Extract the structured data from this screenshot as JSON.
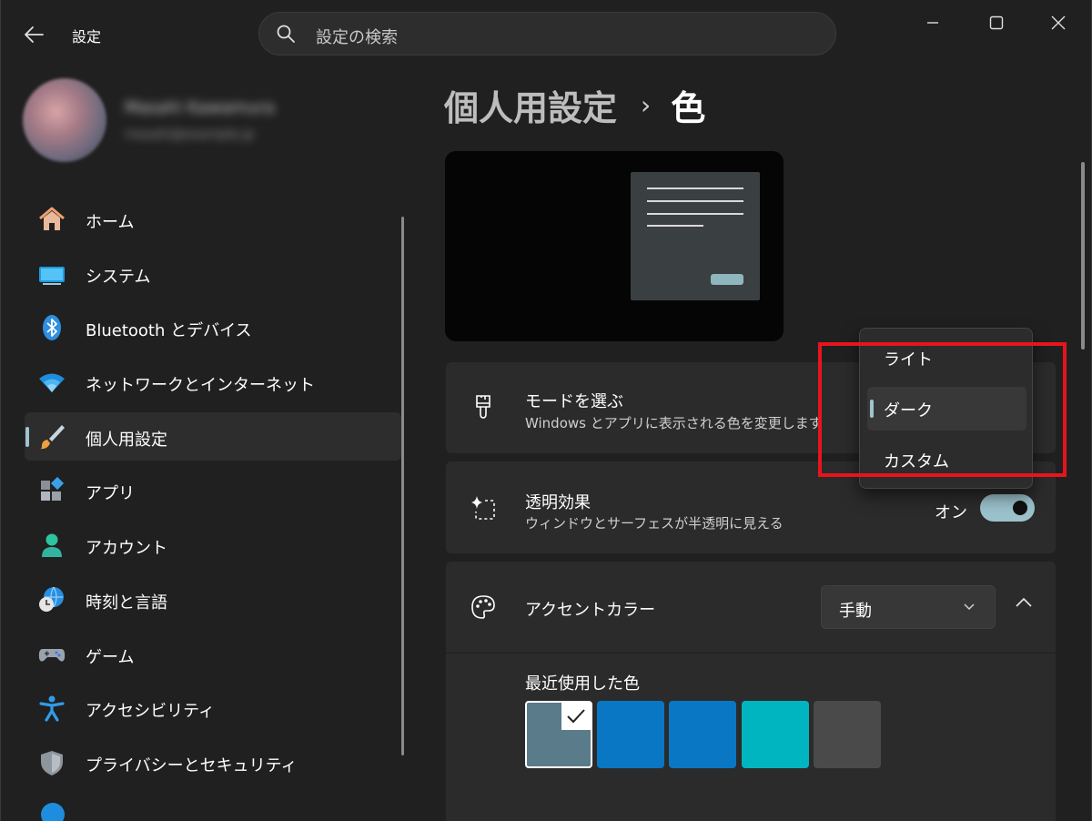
{
  "window": {
    "title": "設定",
    "search_placeholder": "設定の検索"
  },
  "profile": {
    "name": "Masahi Kawamura",
    "email": "masahi@example.jp"
  },
  "sidebar": {
    "items": [
      {
        "label": "ホーム",
        "icon": "home-icon",
        "active": false
      },
      {
        "label": "システム",
        "icon": "system-monitor-icon",
        "active": false
      },
      {
        "label": "Bluetooth とデバイス",
        "icon": "bluetooth-icon",
        "active": false
      },
      {
        "label": "ネットワークとインターネット",
        "icon": "wifi-icon",
        "active": false
      },
      {
        "label": "個人用設定",
        "icon": "paintbrush-icon",
        "active": true
      },
      {
        "label": "アプリ",
        "icon": "apps-icon",
        "active": false
      },
      {
        "label": "アカウント",
        "icon": "account-icon",
        "active": false
      },
      {
        "label": "時刻と言語",
        "icon": "time-language-icon",
        "active": false
      },
      {
        "label": "ゲーム",
        "icon": "gamepad-icon",
        "active": false
      },
      {
        "label": "アクセシビリティ",
        "icon": "accessibility-icon",
        "active": false
      },
      {
        "label": "プライバシーとセキュリティ",
        "icon": "shield-icon",
        "active": false
      }
    ]
  },
  "breadcrumb": {
    "parent": "個人用設定",
    "separator": "›",
    "current": "色"
  },
  "mode": {
    "title": "モードを選ぶ",
    "subtitle": "Windows とアプリに表示される色を変更します",
    "options": [
      "ライト",
      "ダーク",
      "カスタム"
    ],
    "selected": "ダーク"
  },
  "transparency": {
    "title": "透明効果",
    "subtitle": "ウィンドウとサーフェスが半透明に見える",
    "state_label": "オン",
    "on": true
  },
  "accent": {
    "title": "アクセントカラー",
    "dropdown_value": "手動",
    "recent_title": "最近使用した色",
    "recent_colors": [
      "#5a7c8a",
      "#0a77c4",
      "#0a77c4",
      "#00b5c0",
      "#4a4a4a"
    ],
    "selected_index": 0
  },
  "colors": {
    "background": "#202020",
    "card": "#2b2b2b",
    "accent": "#9fc4cf",
    "highlight": "#e8141c"
  }
}
